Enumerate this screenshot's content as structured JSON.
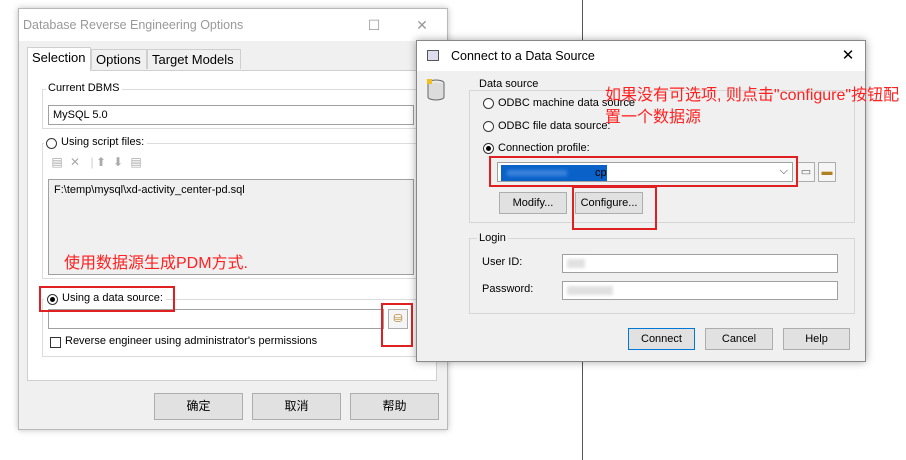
{
  "dialog1": {
    "title": "Database Reverse Engineering Options",
    "tabs": [
      "Selection",
      "Options",
      "Target Models"
    ],
    "current_dbms_label": "Current DBMS",
    "current_dbms_value": "MySQL 5.0",
    "using_script_files_label": "Using script files:",
    "script_file_path": "F:\\temp\\mysql\\xd-activity_center-pd.sql",
    "annotation_text": "使用数据源生成PDM方式.",
    "using_data_source_label": "Using a data source:",
    "data_source_value": "",
    "reverse_admin_label": "Reverse engineer using administrator's permissions",
    "buttons": {
      "ok": "确定",
      "cancel": "取消",
      "help": "帮助"
    }
  },
  "dialog2": {
    "title": "Connect to a Data Source",
    "data_source_group": "Data source",
    "odbc_machine": "ODBC machine data source",
    "odbc_file": "ODBC file data source:",
    "connection_profile": "Connection profile:",
    "profile_selected_text": "cp",
    "modify_button": "Modify...",
    "configure_button": "Configure...",
    "annotation_text": "如果没有可选项, 则点击\"configure\"按钮配置一个数据源",
    "login_group": "Login",
    "user_id_label": "User ID:",
    "password_label": "Password:",
    "buttons": {
      "connect": "Connect",
      "cancel": "Cancel",
      "help": "Help"
    }
  },
  "colors": {
    "annotation_red": "#ff2020",
    "selection_blue": "#0a62c9"
  }
}
